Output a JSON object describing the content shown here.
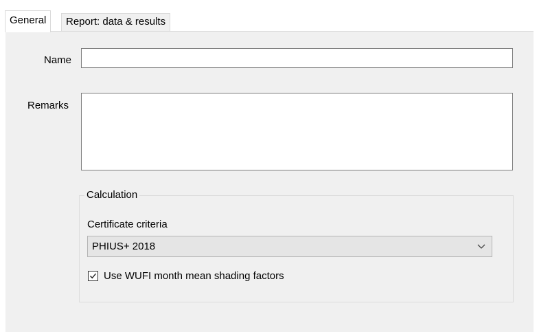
{
  "tabs": [
    {
      "label": "General",
      "active": true
    },
    {
      "label": "Report: data & results",
      "active": false
    }
  ],
  "general": {
    "name_label": "Name",
    "name_value": "",
    "remarks_label": "Remarks",
    "remarks_value": ""
  },
  "calculation": {
    "group_title": "Calculation",
    "criteria_label": "Certificate criteria",
    "criteria_selected": "PHIUS+ 2018",
    "criteria_icon": "chevron-down-icon",
    "shading_checkbox_label": "Use WUFI month mean shading factors",
    "shading_checked": true
  },
  "colors": {
    "panel_background": "#f0f0f0",
    "dropdown_background": "#e5e5e5",
    "input_border": "#7a7a7a"
  }
}
